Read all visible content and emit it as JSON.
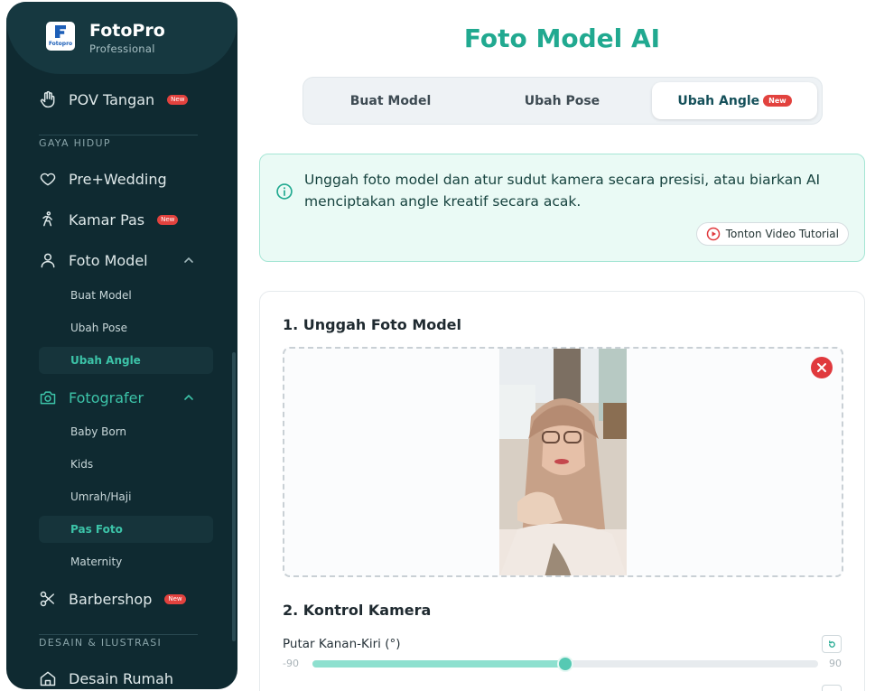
{
  "brand": {
    "name": "FotoPro",
    "subtitle": "Professional",
    "logo_text": "Fotopro"
  },
  "sidebar": {
    "items_top": [
      {
        "label": "POV Tangan",
        "icon": "hand-icon",
        "badge": "New"
      }
    ],
    "section_lifestyle": "GAYA HIDUP",
    "prewedding": {
      "label": "Pre+Wedding",
      "icon": "heart-icon"
    },
    "kamar_pas": {
      "label": "Kamar Pas",
      "icon": "fitting-icon",
      "badge": "New"
    },
    "foto_model": {
      "label": "Foto Model",
      "icon": "user-icon",
      "children": [
        "Buat Model",
        "Ubah Pose",
        "Ubah Angle"
      ],
      "active_child": "Ubah Angle"
    },
    "fotografer": {
      "label": "Fotografer",
      "icon": "camera-icon",
      "children": [
        "Baby Born",
        "Kids",
        "Umrah/Haji",
        "Pas Foto",
        "Maternity"
      ],
      "active_child": "Pas Foto"
    },
    "barbershop": {
      "label": "Barbershop",
      "icon": "scissors-icon",
      "badge": "New"
    },
    "section_design": "DESAIN & ILUSTRASI",
    "desain_rumah": {
      "label": "Desain Rumah",
      "icon": "home-icon"
    }
  },
  "main": {
    "title": "Foto Model AI",
    "tabs": [
      {
        "label": "Buat Model"
      },
      {
        "label": "Ubah Pose"
      },
      {
        "label": "Ubah Angle",
        "badge": "New",
        "active": true
      }
    ],
    "info": {
      "text": "Unggah foto model dan atur sudut kamera secara presisi, atau biarkan AI menciptakan angle kreatif secara acak.",
      "tutorial_button": "Tonton Video Tutorial"
    },
    "upload": {
      "heading": "1. Unggah Foto Model"
    },
    "camera": {
      "heading": "2. Kontrol Kamera",
      "slider_label": "Putar Kanan-Kiri (°)",
      "min": "-90",
      "max": "90",
      "value": 0
    }
  },
  "colors": {
    "accent": "#21a990",
    "sidebar_bg": "#0f2a31",
    "badge": "#e2423e"
  }
}
